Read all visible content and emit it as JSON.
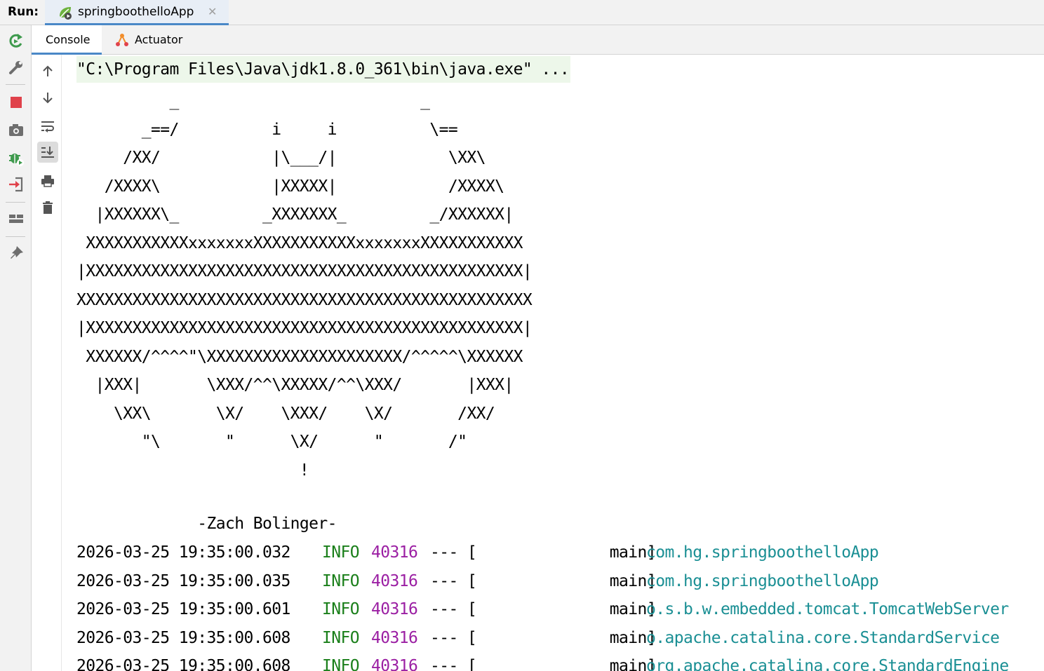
{
  "runbar": {
    "label": "Run:",
    "tab_label": "springboothelloApp",
    "close_glyph": "✕"
  },
  "outer_toolbar": {
    "icons": [
      "rerun-icon",
      "wrench-icon",
      "stop-icon",
      "camera-icon",
      "debug-icon",
      "exit-icon",
      "layout-icon",
      "pin-icon"
    ]
  },
  "tabs": {
    "console": "Console",
    "actuator": "Actuator"
  },
  "inner_toolbar": {
    "icons": [
      "arrow-up-icon",
      "arrow-down-icon",
      "soft-wrap-icon",
      "scroll-to-end-icon",
      "print-icon",
      "trash-icon"
    ]
  },
  "console": {
    "command": "\"C:\\Program Files\\Java\\jdk1.8.0_361\\bin\\java.exe\" ...",
    "banner": "          _                          _\n       _==/          i     i          \\==\n     /XX/            |\\___/|            \\XX\\\n   /XXXX\\            |XXXXX|            /XXXX\\\n  |XXXXXX\\_         _XXXXXXX_         _/XXXXXX|\n XXXXXXXXXXXxxxxxxxXXXXXXXXXXXxxxxxxxXXXXXXXXXXX\n|XXXXXXXXXXXXXXXXXXXXXXXXXXXXXXXXXXXXXXXXXXXXXXX|\nXXXXXXXXXXXXXXXXXXXXXXXXXXXXXXXXXXXXXXXXXXXXXXXXX\n|XXXXXXXXXXXXXXXXXXXXXXXXXXXXXXXXXXXXXXXXXXXXXXX|\n XXXXXX/^^^^\"\\XXXXXXXXXXXXXXXXXXXXX/^^^^^\\XXXXXX\n  |XXX|       \\XXX/^^\\XXXXX/^^\\XXX/       |XXX|\n    \\XX\\       \\X/    \\XXX/    \\X/       /XX/\n       \"\\       \"      \\X/      \"       /\"\n                        !",
    "author": "             -Zach Bolinger-",
    "logs": [
      {
        "ts": "2026-03-25 19:35:00.032",
        "level": "INFO",
        "pid": "40316",
        "sep": "--- [",
        "thread": "main]",
        "logger": "com.hg.springboothelloApp"
      },
      {
        "ts": "2026-03-25 19:35:00.035",
        "level": "INFO",
        "pid": "40316",
        "sep": "--- [",
        "thread": "main]",
        "logger": "com.hg.springboothelloApp"
      },
      {
        "ts": "2026-03-25 19:35:00.601",
        "level": "INFO",
        "pid": "40316",
        "sep": "--- [",
        "thread": "main]",
        "logger": "o.s.b.w.embedded.tomcat.TomcatWebServer"
      },
      {
        "ts": "2026-03-25 19:35:00.608",
        "level": "INFO",
        "pid": "40316",
        "sep": "--- [",
        "thread": "main]",
        "logger": "o.apache.catalina.core.StandardService"
      },
      {
        "ts": "2026-03-25 19:35:00.608",
        "level": "INFO",
        "pid": "40316",
        "sep": "--- [",
        "thread": "main]",
        "logger": "org.apache.catalina.core.StandardEngine"
      }
    ]
  },
  "colors": {
    "accent": "#4a88c7",
    "info": "#1a7f1a",
    "pid": "#9b1fa3",
    "logger": "#1a8f94",
    "command_bg": "#edf7ea"
  }
}
